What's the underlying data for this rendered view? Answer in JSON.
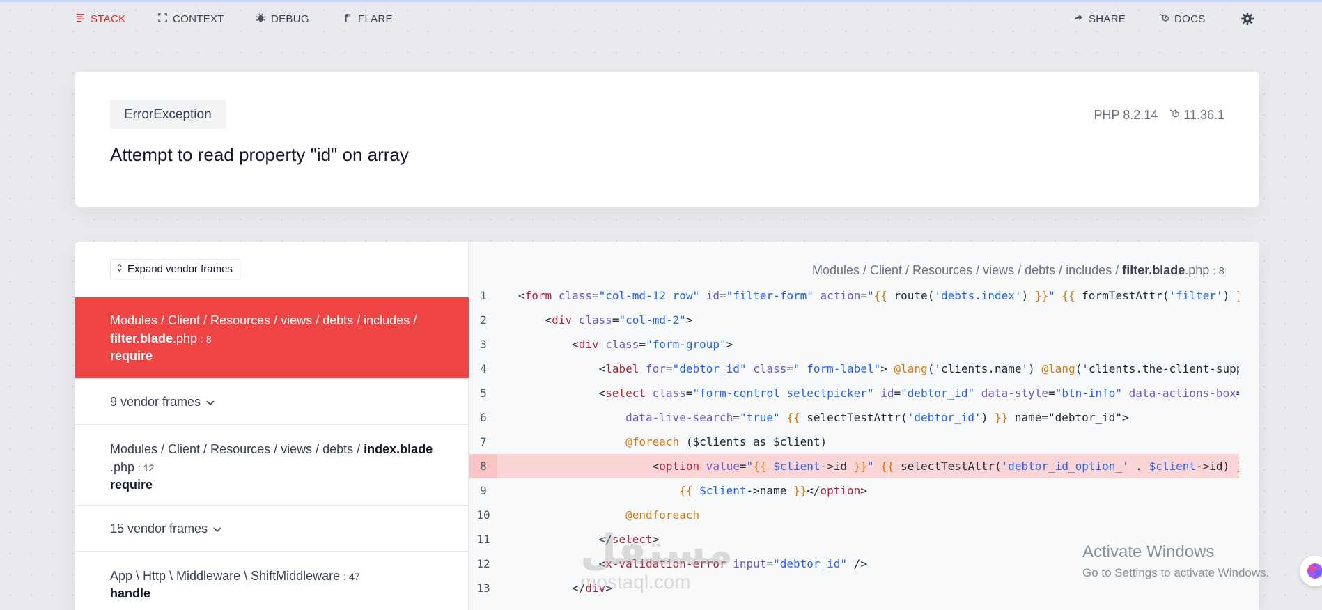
{
  "nav": {
    "stack": "STACK",
    "context": "CONTEXT",
    "debug": "DEBUG",
    "flare": "FLARE",
    "share": "SHARE",
    "docs": "DOCS"
  },
  "header": {
    "exception": "ErrorException",
    "message": "Attempt to read property \"id\" on array",
    "php_version": "PHP 8.2.14",
    "laravel_version": "11.36.1"
  },
  "frames": {
    "expand_label": "Expand vendor frames",
    "items": [
      {
        "path_prefix": "Modules / Client / Resources / views / debts / includes /",
        "file_bold": "filter.blade",
        "ext": ".php",
        "line": ": 8",
        "method": "require"
      },
      {
        "vendor": "9 vendor frames"
      },
      {
        "path_prefix": "Modules / Client / Resources / views / debts /",
        "file_bold": "index.blade",
        "ext": ".php",
        "line": ": 12",
        "method": "require"
      },
      {
        "vendor": "15 vendor frames"
      },
      {
        "path_prefix": "App \\ Http \\ Middleware \\ ShiftMiddleware",
        "line": ": 47",
        "method": "handle"
      }
    ]
  },
  "code": {
    "file_prefix": "Modules / Client / Resources / views / debts / includes /",
    "file_bold": "filter.blade",
    "file_ext": ".php",
    "file_line": ": 8",
    "line_numbers": [
      "1",
      "2",
      "3",
      "4",
      "5",
      "6",
      "7",
      "8",
      "9",
      "10",
      "11",
      "12",
      "13"
    ],
    "highlight_line": 8
  },
  "overlay": {
    "watermark": "مستقل",
    "watermark_sub": "mostaql.com",
    "activate_title": "Activate Windows",
    "activate_sub": "Go to Settings to activate Windows."
  },
  "colors": {
    "accent": "#ef4444",
    "highlight": "#fbd5d5"
  }
}
